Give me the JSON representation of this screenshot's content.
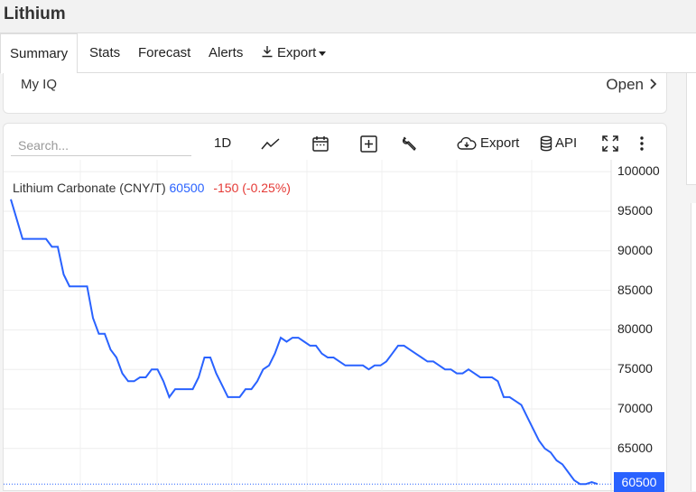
{
  "app": {
    "title": "Lithium"
  },
  "tabs": [
    {
      "label": "Summary"
    },
    {
      "label": "Stats"
    },
    {
      "label": "Forecast"
    },
    {
      "label": "Alerts"
    },
    {
      "label": "Export"
    }
  ],
  "myiq": {
    "label": "My IQ",
    "open_label": "Open"
  },
  "toolbar": {
    "search_placeholder": "Search...",
    "interval_label": "1D",
    "export_label": "Export",
    "api_label": "API"
  },
  "legend": {
    "name": "Lithium Carbonate (CNY/T)",
    "value": "60500",
    "change": "-150 (-0.25%)"
  },
  "accent_color": "#2962ff",
  "negative_color": "#e53935",
  "chart_data": {
    "type": "line",
    "title": "",
    "xlabel": "",
    "ylabel": "",
    "ylim": [
      59500,
      101500
    ],
    "grid": true,
    "y_ticks": [
      "100000",
      "95000",
      "90000",
      "85000",
      "80000",
      "75000",
      "70000",
      "65000",
      "60500"
    ],
    "last_value_label": "60500",
    "series": [
      {
        "values": [
          96500,
          94000,
          91500,
          91500,
          91500,
          91500,
          91500,
          90500,
          90500,
          87000,
          85500,
          85500,
          85500,
          85500,
          81500,
          79500,
          79500,
          77500,
          76500,
          74500,
          73500,
          73500,
          74000,
          74000,
          75000,
          75000,
          73500,
          71500,
          72500,
          72500,
          72500,
          72500,
          74000,
          76500,
          76500,
          74500,
          73000,
          71500,
          71500,
          71500,
          72500,
          72500,
          73500,
          75000,
          75500,
          77000,
          79000,
          78500,
          79000,
          79000,
          78500,
          78000,
          78000,
          77000,
          76500,
          76500,
          76000,
          75500,
          75500,
          75500,
          75500,
          75000,
          75500,
          75500,
          76000,
          77000,
          78000,
          78000,
          77500,
          77000,
          76500,
          76000,
          76000,
          75500,
          75000,
          75000,
          74500,
          74500,
          75000,
          74500,
          74000,
          74000,
          74000,
          73500,
          71500,
          71500,
          71000,
          70500,
          69000,
          67500,
          66000,
          65000,
          64500,
          63500,
          63000,
          62000,
          61000,
          60500,
          60500,
          60750,
          60500
        ]
      }
    ]
  }
}
